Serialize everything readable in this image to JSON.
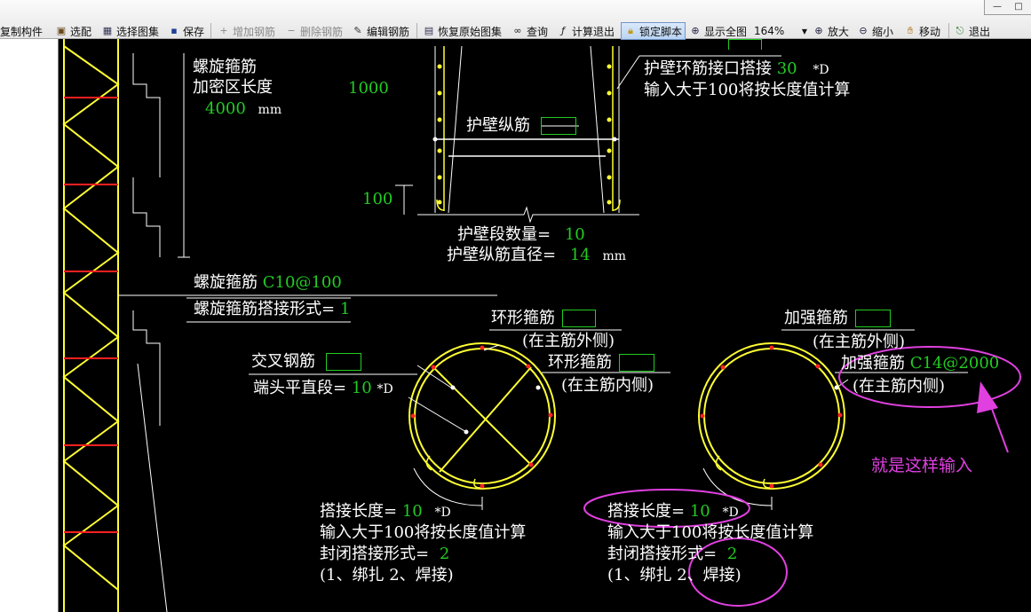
{
  "toolbar": {
    "items": [
      {
        "label": "复制构件",
        "icon": "copy-icon",
        "enabled": true
      },
      {
        "label": "选配",
        "icon": "select-icon",
        "enabled": true
      },
      {
        "label": "选择图集",
        "icon": "atlas-icon",
        "enabled": true
      },
      {
        "label": "保存",
        "icon": "save-icon",
        "enabled": true
      },
      {
        "label": "增加钢筋",
        "icon": "add-rebar-icon",
        "enabled": false
      },
      {
        "label": "删除钢筋",
        "icon": "delete-rebar-icon",
        "enabled": false
      },
      {
        "label": "编辑钢筋",
        "icon": "edit-rebar-icon",
        "enabled": true
      },
      {
        "label": "恢复原始图集",
        "icon": "restore-icon",
        "enabled": true
      },
      {
        "label": "查询",
        "icon": "binoculars-icon",
        "enabled": true
      },
      {
        "label": "计算退出",
        "icon": "fx-icon",
        "enabled": true
      },
      {
        "label": "锁定脚本",
        "icon": "lock-icon",
        "enabled": true,
        "active": true
      },
      {
        "label": "显示全图",
        "icon": "show-all-icon",
        "enabled": true
      },
      {
        "label": "放大",
        "icon": "zoom-in-icon",
        "enabled": true
      },
      {
        "label": "缩小",
        "icon": "zoom-out-icon",
        "enabled": true
      },
      {
        "label": "移动",
        "icon": "hand-icon",
        "enabled": true
      },
      {
        "label": "退出",
        "icon": "exit-icon",
        "enabled": true
      }
    ],
    "zoom": "164%"
  },
  "drawing": {
    "spiral_label": "螺旋箍筋",
    "dense_zone_label": "加密区长度",
    "dense_zone_value": "4000",
    "unit_mm": "mm",
    "dim_1000": "1000",
    "dim_100": "100",
    "wall_ring_lap_label": "护壁环筋接口搭接",
    "wall_ring_lap_value": "30",
    "times_d": "*D",
    "length_note": "输入大于100将按长度值计算",
    "wall_long_bar": "护壁纵筋",
    "wall_segment_count_label": "护壁段数量=",
    "wall_segment_count_value": "10",
    "wall_long_diameter_label": "护壁纵筋直径=",
    "wall_long_diameter_value": "14",
    "spiral_stirrup_value": "C10@100",
    "spiral_lap_form_label": "螺旋箍筋搭接形式=",
    "spiral_lap_form_value": "1",
    "cross_bar_label": "交叉钢筋",
    "end_straight_label": "端头平直段=",
    "end_straight_value": "10",
    "ring_stirrup_label": "环形箍筋",
    "outside_main": "(在主筋外侧)",
    "inside_main": "(在主筋内侧)",
    "strength_stirrup_label": "加强箍筋",
    "strength_stirrup_value": "C14@2000",
    "lap_length_label": "搭接长度=",
    "lap_length_value_left": "10",
    "lap_length_value_right": "10",
    "closed_lap_label": "封闭搭接形式=",
    "closed_lap_value_left": "2",
    "closed_lap_value_right": "2",
    "lap_options": "(1、绑扎  2、焊接)",
    "annotation_text": "就是这样输入"
  },
  "colors": {
    "rebar_yellow": "#ffff33",
    "value_green": "#22cc22",
    "annotation_magenta": "#e040e0",
    "point_red": "#ff2222",
    "ladder_red": "#ff2020"
  }
}
